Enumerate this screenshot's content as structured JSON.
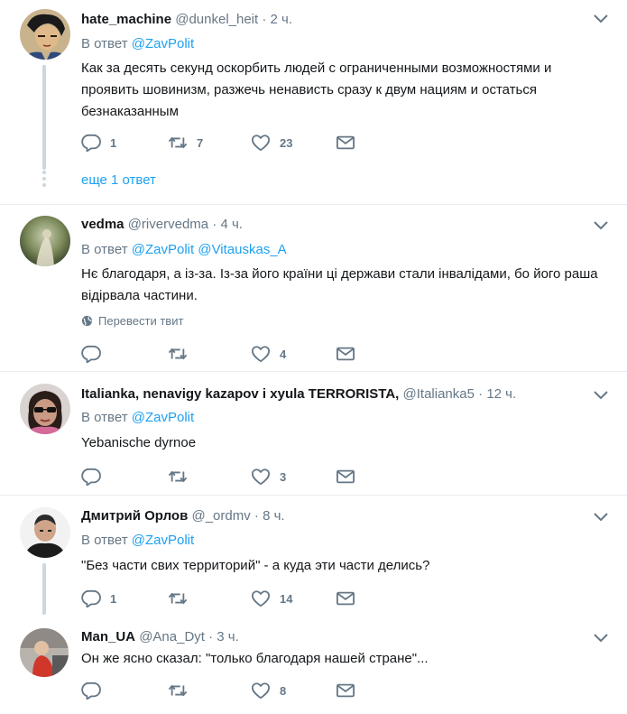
{
  "reply_prefix": "В ответ",
  "tweets": [
    {
      "name": "hate_machine",
      "handle": "@dunkel_heit",
      "time": "2 ч.",
      "reply_to": "@ZavPolit",
      "reply_to_2": "",
      "text": "Как за десять секунд оскорбить людей с ограниченными возможностями и проявить шовинизм, разжечь ненависть сразу к двум нациям и остаться безнаказанным",
      "replies": "1",
      "retweets": "7",
      "likes": "23",
      "more_replies": "еще 1 ответ"
    },
    {
      "name": "vedma",
      "handle": "@rivervedma",
      "time": "4 ч.",
      "reply_to": "@ZavPolit",
      "reply_to_2": "@Vitauskas_A",
      "text": "Нє благодаря, а із-за. Із-за його країни ці держави стали інвалідами, бо його раша відірвала частини.",
      "translate": "Перевести твит",
      "replies": "",
      "retweets": "",
      "likes": "4"
    },
    {
      "name": "Italianka, nenavigy kazapov i xyula TERRORISTA,",
      "handle": "@Italianka5",
      "time": "12 ч.",
      "reply_to": "@ZavPolit",
      "text": "Yebanische dyrnoe",
      "replies": "",
      "retweets": "",
      "likes": "3"
    },
    {
      "name": "Дмитрий Орлов",
      "handle": "@_ordmv",
      "time": "8 ч.",
      "reply_to": "@ZavPolit",
      "text": "\"Без части свих территорий\" - а куда эти части делись?",
      "replies": "1",
      "retweets": "",
      "likes": "14"
    },
    {
      "name": "Man_UA",
      "handle": "@Ana_Dyt",
      "time": "3 ч.",
      "text": "Он же ясно сказал: \"только благодаря нашей стране\"...",
      "replies": "",
      "retweets": "",
      "likes": "8"
    }
  ],
  "colors": {
    "link": "#1da1f2",
    "muted": "#657786",
    "border": "#e6ecf0"
  }
}
